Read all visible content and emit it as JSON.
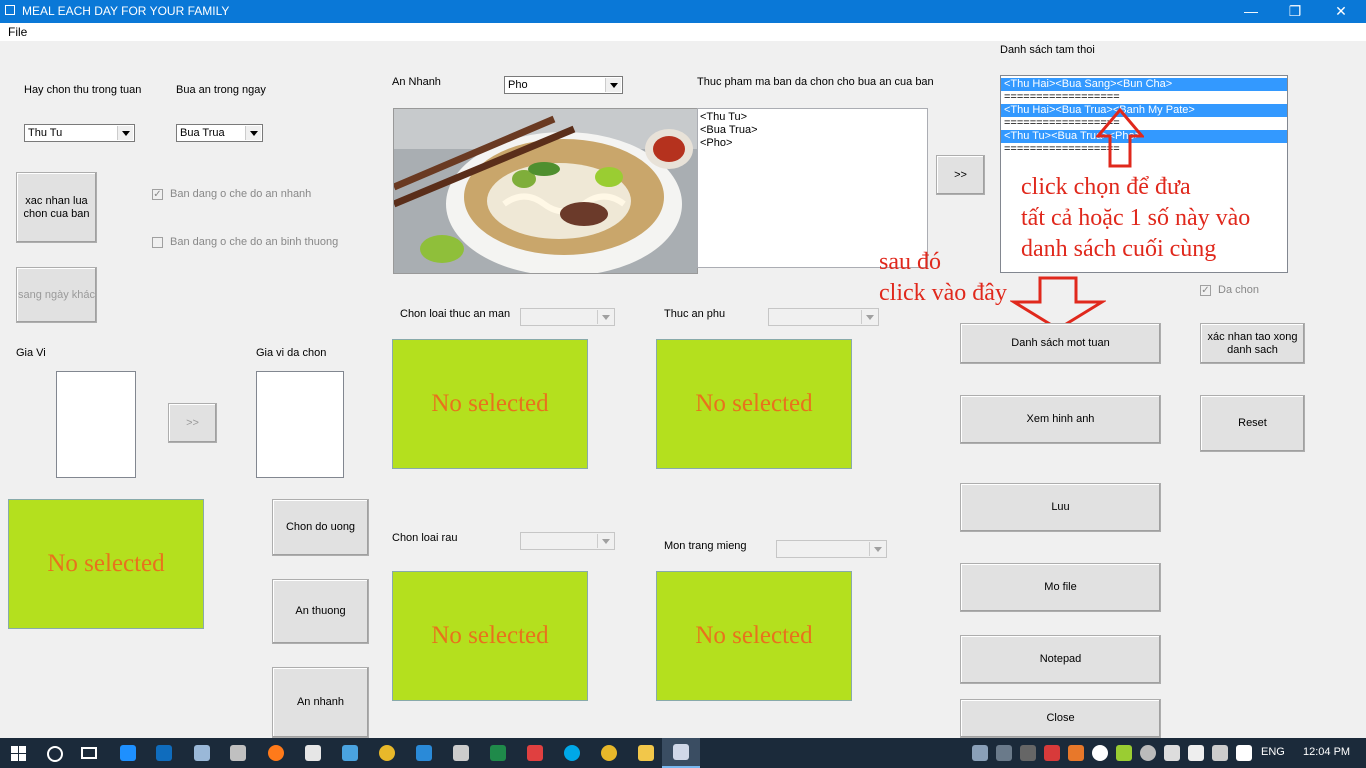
{
  "window": {
    "title": "MEAL EACH DAY FOR YOUR FAMILY",
    "minimize": "—",
    "restore": "❐",
    "close": "✕"
  },
  "menu": {
    "file": "File"
  },
  "left": {
    "day_label": "Hay chon thu trong tuan",
    "day_value": "Thu Tu",
    "meal_label": "Bua an trong ngay",
    "meal_value": "Bua Trua",
    "confirm_button": "xac nhan lua chon cua ban",
    "next_day_button": "sang ngày khác",
    "fastfood_checkbox": "Ban dang o che do an nhanh",
    "normal_checkbox": "Ban dang o che do an binh thuong",
    "spice_label": "Gia Vi",
    "chosen_spice_label": "Gia vi da chon",
    "move_button": ">>",
    "no_selected": "No selected",
    "drink_button": "Chon do uong",
    "normal_food_button": "An thuong",
    "fastfood_button": "An nhanh"
  },
  "middle": {
    "fastfood_label": "An Nhanh",
    "fastfood_value": "Pho",
    "chosen_label": "Thuc pham ma ban da chon cho bua an cua ban",
    "chosen_lines": [
      "<Thu Tu>",
      "<Bua Trua>",
      "<Pho>"
    ],
    "add_button": ">>",
    "salty_label": "Chon loai thuc an man",
    "side_label": "Thuc an phu",
    "veg_label": "Chon loai rau",
    "dessert_label": "Mon trang mieng",
    "no_selected": "No selected"
  },
  "right": {
    "temp_list_label": "Danh sách tam thoi",
    "temp_items": [
      {
        "text": "<Thu Hai><Bua Sang><Bun Cha>",
        "selected": true
      },
      {
        "text": "==================",
        "selected": false
      },
      {
        "text": "<Thu Hai><Bua Trua><Banh My Pate>",
        "selected": true
      },
      {
        "text": "==================",
        "selected": false
      },
      {
        "text": "<Thu Tu><Bua Trua><Pho>",
        "selected": true
      },
      {
        "text": "==================",
        "selected": false
      }
    ],
    "annotation_1": [
      "click chọn để đưa",
      "tất cả hoặc 1 số này vào",
      "danh sách cuối cùng"
    ],
    "annotation_2": [
      "sau đó",
      "click vào đây"
    ],
    "selected_checkbox": "Da chon",
    "week_list_button": "Danh sách mot tuan",
    "confirm_done_button": "xác nhan tao xong danh sach",
    "view_image_button": "Xem hinh anh",
    "reset_button": "Reset",
    "save_button": "Luu",
    "open_file_button": "Mo file",
    "notepad_button": "Notepad",
    "close_button": "Close",
    "annotation_color": "#e0281c"
  },
  "taskbar": {
    "lang": "ENG",
    "time": "12:04 PM"
  }
}
